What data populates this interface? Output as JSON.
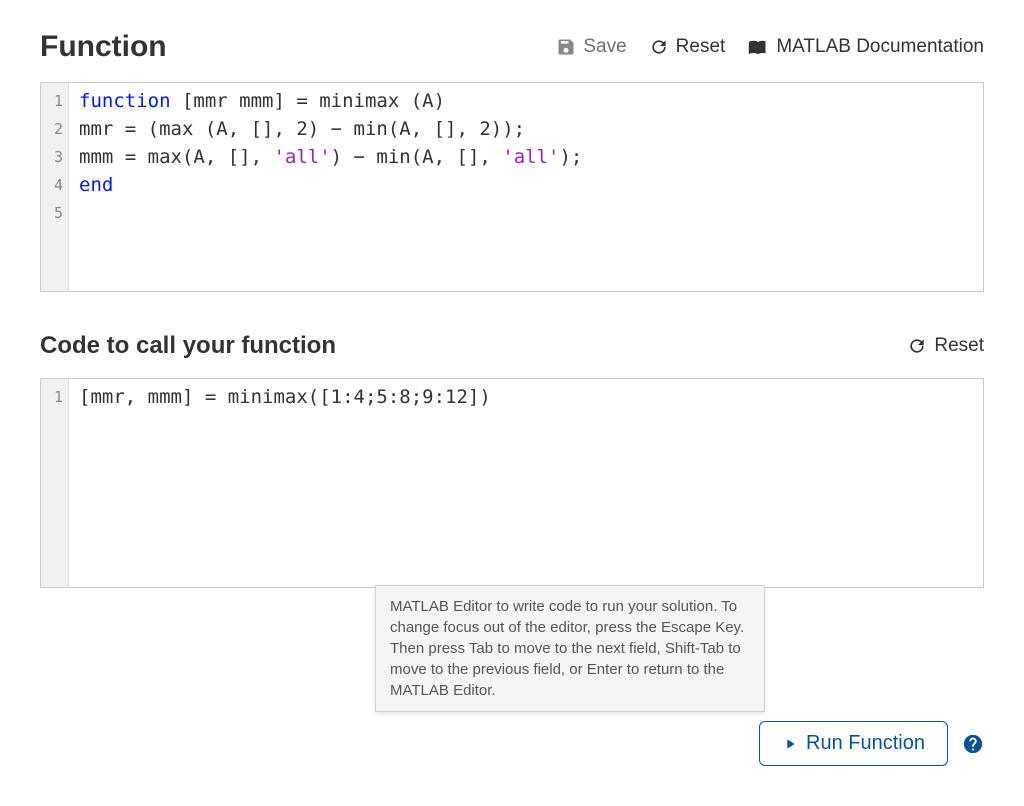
{
  "section1": {
    "title": "Function",
    "toolbar": {
      "save": "Save",
      "reset": "Reset",
      "docs": "MATLAB Documentation"
    }
  },
  "editor1": {
    "gutter": [
      "1",
      "2",
      "3",
      "4",
      "5"
    ],
    "lines": [
      [
        {
          "t": "function",
          "cls": "kw"
        },
        {
          "t": " [mmr mmm] = minimax (A)",
          "cls": ""
        }
      ],
      [
        {
          "t": "mmr = (max (A, [], 2) − min(A, [], 2));",
          "cls": ""
        }
      ],
      [
        {
          "t": "mmm = max(A, [], ",
          "cls": ""
        },
        {
          "t": "'all'",
          "cls": "str"
        },
        {
          "t": ") − min(A, [], ",
          "cls": ""
        },
        {
          "t": "'all'",
          "cls": "str"
        },
        {
          "t": ");",
          "cls": ""
        }
      ],
      [
        {
          "t": "end",
          "cls": "kw"
        }
      ],
      [
        {
          "t": "",
          "cls": ""
        }
      ]
    ]
  },
  "section2": {
    "title": "Code to call your function",
    "toolbar": {
      "reset": "Reset"
    }
  },
  "editor2": {
    "gutter": [
      "1"
    ],
    "lines": [
      [
        {
          "t": "[mmr, mmm] = minimax([1:4;5:8;9:12])",
          "cls": ""
        }
      ]
    ]
  },
  "tooltip": "MATLAB Editor to write code to run your solution. To change focus out of the editor, press the Escape Key. Then press Tab to move to the next field, Shift-Tab to move to the previous field, or Enter to return to the MATLAB Editor.",
  "footer": {
    "run": "Run Function"
  }
}
